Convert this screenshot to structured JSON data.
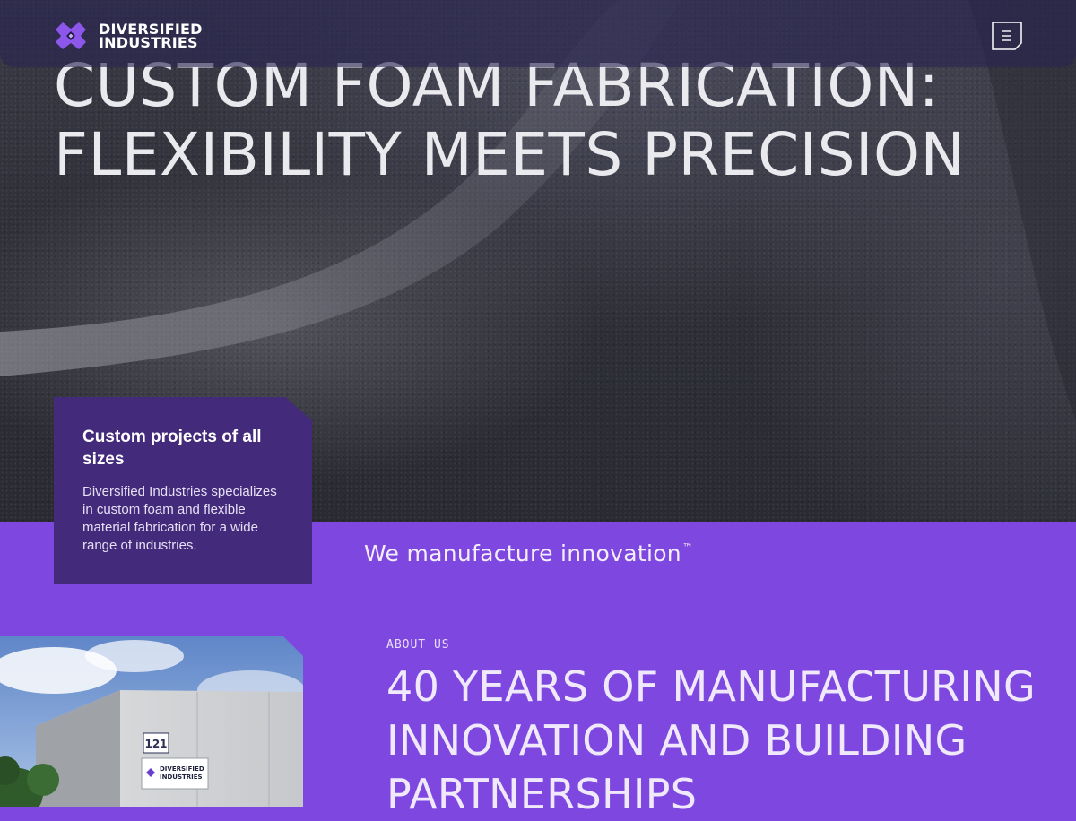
{
  "header": {
    "logo_line1": "DIVERSIFIED",
    "logo_line2": "INDUSTRIES",
    "menu_icon": "hamburger-menu-icon"
  },
  "hero": {
    "title_line1": "CUSTOM FOAM FABRICATION:",
    "title_line2": "FLEXIBILITY MEETS PRECISION"
  },
  "card": {
    "title": "Custom projects of all sizes",
    "text": "Diversified Industries specializes in custom foam and flexible material fabrication for a wide range of industries."
  },
  "tagline": {
    "text": "We manufacture innovation",
    "trademark": "™"
  },
  "building": {
    "sign_number": "121",
    "sign_line1": "DIVERSIFIED",
    "sign_line2": "INDUSTRIES"
  },
  "about": {
    "eyebrow": "ABOUT US",
    "title_line1": "40 YEARS OF MANUFACTURING",
    "title_line2": "INNOVATION AND BUILDING",
    "title_line3": "PARTNERSHIPS"
  },
  "colors": {
    "brand_purple": "#7e48e0",
    "card_purple": "#432a7a",
    "nav_bg": "#28244f"
  }
}
